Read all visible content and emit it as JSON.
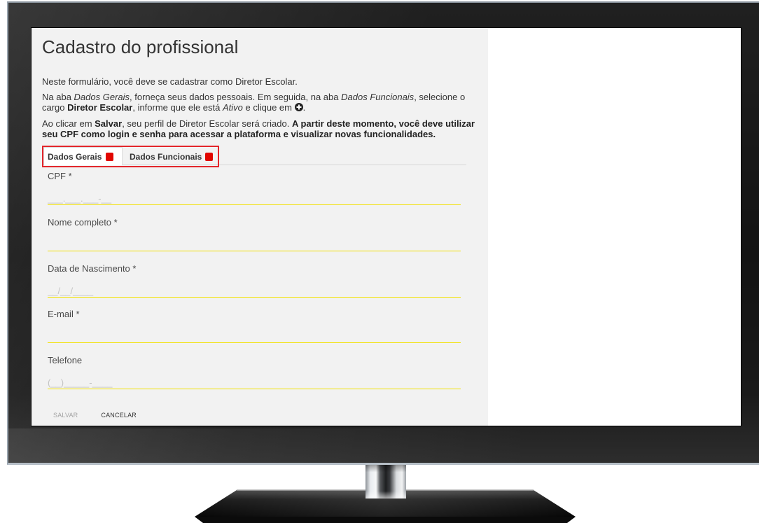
{
  "page": {
    "title": "Cadastro do profissional"
  },
  "intro": {
    "p1": "Neste formulário, você deve se cadastrar como Diretor Escolar.",
    "p2": [
      "Na aba ",
      "Dados Gerais",
      ", forneça seus dados pessoais. Em seguida, na aba ",
      "Dados Funcionais",
      ", selecione o cargo ",
      "Diretor Escolar",
      ", informe que ele está ",
      "Ativo",
      " e clique em ",
      "."
    ],
    "p3": [
      "Ao clicar em ",
      "Salvar",
      ", seu perfil de Diretor Escolar será criado. ",
      "A partir deste momento, você deve utilizar seu CPF como login e senha para acessar a plataforma e visualizar novas funcionalidades."
    ]
  },
  "tabs": [
    {
      "label": "Dados Gerais",
      "active": true,
      "has_badge": true
    },
    {
      "label": "Dados Funcionais",
      "active": false,
      "has_badge": true
    }
  ],
  "fields": [
    {
      "label": "CPF *",
      "placeholder": "___.___.___-__"
    },
    {
      "label": "Nome completo *"
    },
    {
      "label": "Data de Nascimento *",
      "placeholder": "__/__/____"
    },
    {
      "label": "E-mail *"
    },
    {
      "label": "Telefone",
      "placeholder": "(__)_____-____"
    }
  ],
  "actions": {
    "save_label": "SALVAR",
    "cancel_label": "CANCELAR",
    "save_enabled": false
  },
  "icons": {
    "add": "plus-circle-icon",
    "tab_badge": "tab-badge"
  },
  "colors": {
    "panel_background": "#f2f2f2",
    "field_underline": "#f2e100",
    "badge": "#e10600",
    "highlight_outline": "#e3262b"
  }
}
